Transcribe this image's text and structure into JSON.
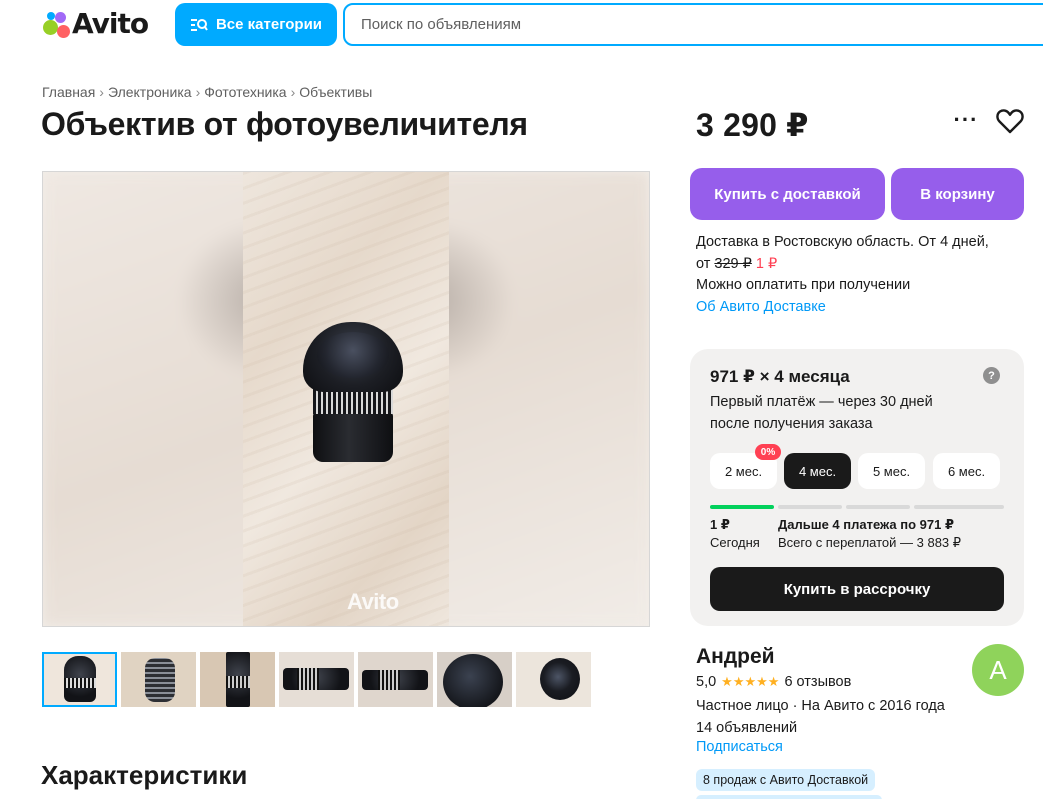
{
  "header": {
    "logo": "Avito",
    "categories_label": "Все категории",
    "search_placeholder": "Поиск по объявлениям"
  },
  "breadcrumb": [
    "Главная",
    "Электроника",
    "Фототехника",
    "Объективы"
  ],
  "breadcrumb_separator": "›",
  "title": "Объектив от фотоувеличителя",
  "gallery": {
    "watermark": "Avito",
    "thumbnail_count": 7,
    "active_thumbnail": 1
  },
  "section_title": "Характеристики",
  "price": "3 290 ₽",
  "actions": {
    "more": "···",
    "buy_delivery": "Купить с доставкой",
    "add_to_cart": "В корзину"
  },
  "delivery": {
    "line1": "Доставка в Ростовскую область. От 4 дней,",
    "from": "от",
    "old_price": "329 ₽",
    "new_price": "1 ₽",
    "line3": "Можно оплатить при получении",
    "link": "Об Авито Доставке"
  },
  "installment": {
    "title": "971 ₽ × 4 месяца",
    "help": "?",
    "description": "Первый платёж — через 30 дней после получения заказа",
    "terms": [
      "2 мес.",
      "4 мес.",
      "5 мес.",
      "6 мес."
    ],
    "active_term_index": 1,
    "zero_badge": "0%",
    "today_amount": "1 ₽",
    "today_label": "Сегодня",
    "next_payments": "Дальше 4 платежа по 971 ₽",
    "total": "Всего с переплатой — 3 883 ₽",
    "button": "Купить в рассрочку"
  },
  "seller": {
    "name": "Андрей",
    "rating": "5,0",
    "stars": "★★★★★",
    "reviews": "6 отзывов",
    "type": "Частное лицо · На Авито с 2016 года",
    "listings": "14 объявлений",
    "subscribe": "Подписаться",
    "avatar_letter": "А",
    "sales_badge": "8 продаж с Авито Доставкой"
  },
  "colors": {
    "accent_blue": "#00aaff",
    "purple": "#965eeb",
    "link": "#0099f7",
    "red": "#ff4053",
    "green": "#02d15c",
    "avatar": "#8fd35b"
  }
}
